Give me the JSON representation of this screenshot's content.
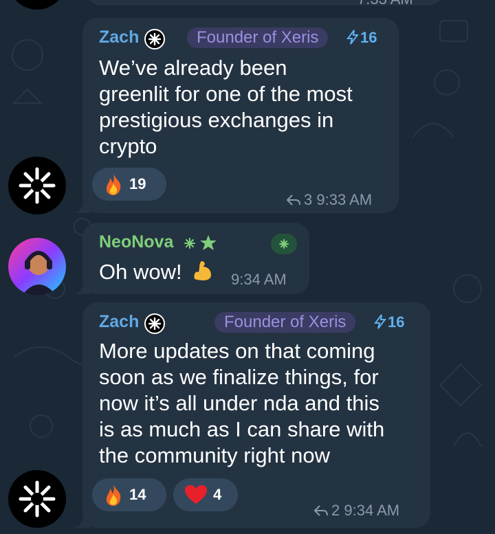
{
  "top_meta": "7:33 AM",
  "messages": [
    {
      "author": "Zach",
      "role": "Founder of Xeris",
      "boost": "16",
      "text_lines": [
        "We’ve already been",
        "greenlit for one of the most",
        "prestigious exchanges in",
        "crypto"
      ],
      "reactions": [
        {
          "icon": "fire-icon",
          "count": "19"
        }
      ],
      "replies": "3",
      "time": "9:33 AM"
    },
    {
      "author": "NeoNova",
      "text": "Oh wow!",
      "time": "9:34 AM"
    },
    {
      "author": "Zach",
      "role": "Founder of Xeris",
      "boost": "16",
      "text_lines": [
        "More updates on that coming",
        "soon as we finalize things, for",
        "now it’s all under nda and this",
        "is as much as I can share with",
        "the community right now"
      ],
      "reactions": [
        {
          "icon": "fire-icon",
          "count": "14"
        },
        {
          "icon": "heart-icon",
          "count": "4"
        }
      ],
      "replies": "2",
      "time": "9:34 AM"
    }
  ],
  "colors": {
    "background": "#1b2836",
    "bubble": "#243342",
    "name_blue": "#61a9e4",
    "name_green": "#7fcf7a",
    "role_pill_bg": "#3b3c63",
    "role_text": "#9d8fe0",
    "meta": "#8b9aab"
  }
}
